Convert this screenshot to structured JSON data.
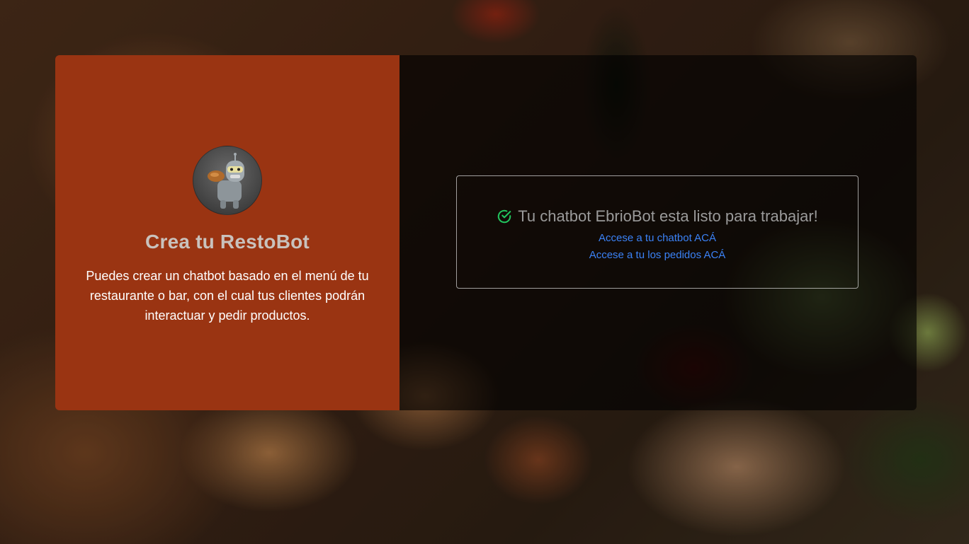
{
  "left": {
    "title": "Crea tu RestoBot",
    "description": "Puedes crear un chatbot basado en el menú de tu restaurante o bar, con el cual tus clientes podrán interactuar y pedir productos."
  },
  "status": {
    "message": "Tu chatbot EbrioBot esta listo para trabajar!",
    "icon": "check-circle-icon",
    "links": [
      {
        "label": "Accese a tu chatbot ACÁ"
      },
      {
        "label": "Accese a tu los pedidos ACÁ"
      }
    ]
  },
  "colors": {
    "left_panel": "#9a3412",
    "success_icon": "#22c55e",
    "link": "#3b82f6"
  }
}
